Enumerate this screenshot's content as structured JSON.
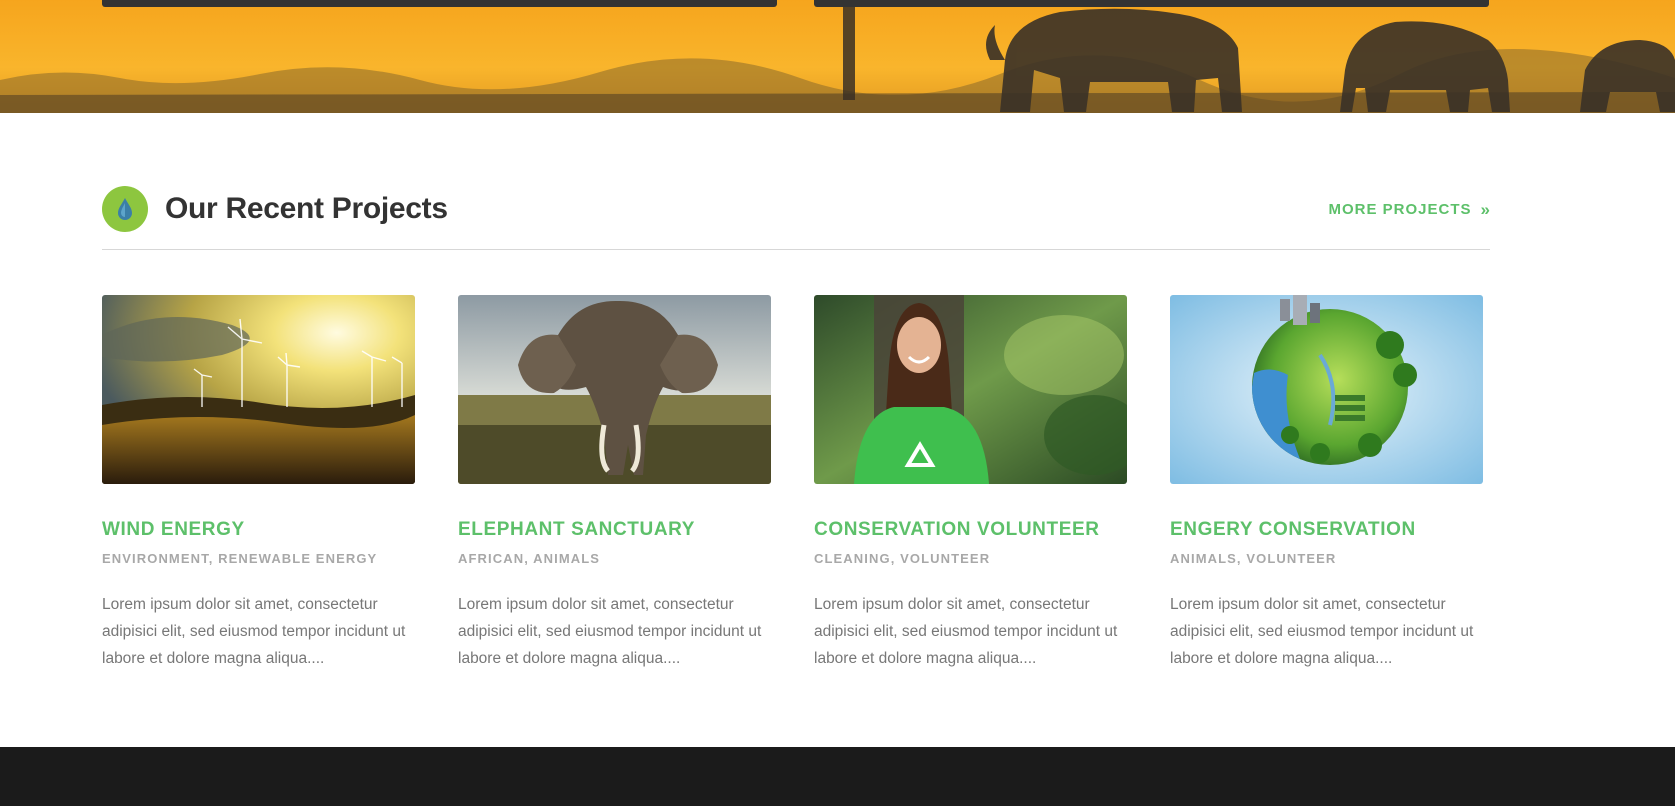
{
  "section": {
    "title": "Our Recent Projects",
    "icon": "water-drop-icon",
    "more_label": "MORE PROJECTS",
    "more_icon": "double-chevron-right-icon"
  },
  "colors": {
    "accent_green": "#5dc06a",
    "icon_circle": "#8dc63f",
    "hero_orange": "#f7b12a",
    "footer": "#1b1b1b"
  },
  "projects": [
    {
      "title": "WIND ENERGY",
      "tags": "ENVIRONMENT, RENEWABLE ENERGY",
      "excerpt": "Lorem ipsum dolor sit amet, consectetur adipisici elit, sed eiusmod tempor incidunt ut labore et dolore magna aliqua....",
      "image": "wind-turbines-sunset-image"
    },
    {
      "title": "ELEPHANT SANCTUARY",
      "tags": "AFRICAN, ANIMALS",
      "excerpt": "Lorem ipsum dolor sit amet, consectetur adipisici elit, sed eiusmod tempor incidunt ut labore et dolore magna aliqua....",
      "image": "elephant-savanna-image"
    },
    {
      "title": "CONSERVATION VOLUNTEER",
      "tags": "CLEANING, VOLUNTEER",
      "excerpt": "Lorem ipsum dolor sit amet, consectetur adipisici elit, sed eiusmod tempor incidunt ut labore et dolore magna aliqua....",
      "image": "volunteer-girl-recycle-shirt-image"
    },
    {
      "title": "ENGERY CONSERVATION",
      "tags": "ANIMALS, VOLUNTEER",
      "excerpt": "Lorem ipsum dolor sit amet, consectetur adipisici elit, sed eiusmod tempor incidunt ut labore et dolore magna aliqua....",
      "image": "green-planet-city-image"
    }
  ]
}
